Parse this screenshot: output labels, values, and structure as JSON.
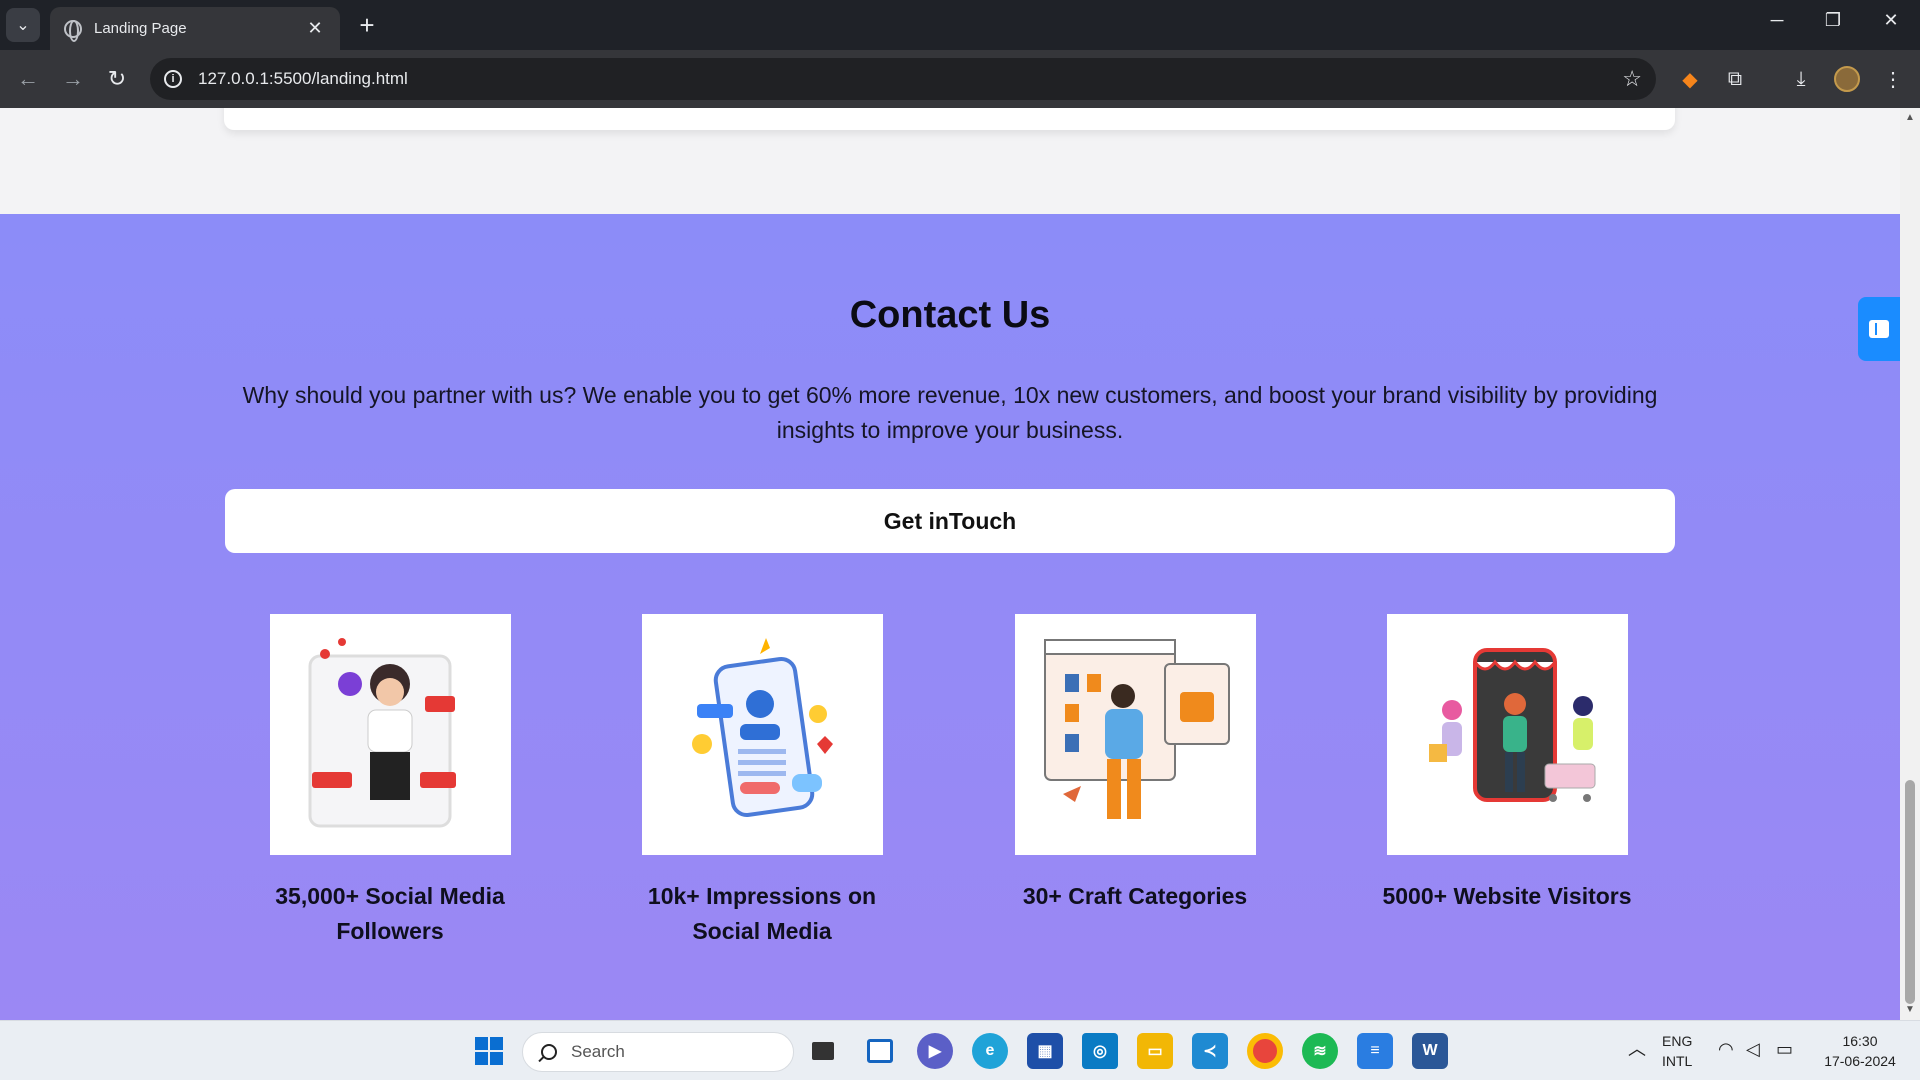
{
  "browser": {
    "tab_title": "Landing Page",
    "url": "127.0.0.1:5500/landing.html"
  },
  "contact": {
    "heading": "Contact Us",
    "lead": "Why should you partner with us? We enable you to get 60% more revenue, 10x new customers, and boost your brand visibility by providing insights to improve your business.",
    "button_label": "Get inTouch",
    "stats": [
      {
        "caption": "35,000+ Social Media Followers",
        "image": "social-media-influencer-illustration"
      },
      {
        "caption": "10k+ Impressions on Social Media",
        "image": "phone-follow-illustration"
      },
      {
        "caption": "30+ Craft Categories",
        "image": "craft-categories-illustration"
      },
      {
        "caption": "5000+ Website Visitors",
        "image": "online-shoppers-illustration"
      }
    ]
  },
  "taskbar": {
    "search_placeholder": "Search",
    "lang_top": "ENG",
    "lang_bottom": "INTL",
    "time": "16:30",
    "date": "17-06-2024"
  },
  "colors": {
    "section_bg": "#8c8cf8",
    "browser_frame": "#35363a",
    "side_button": "#1a8cff"
  }
}
